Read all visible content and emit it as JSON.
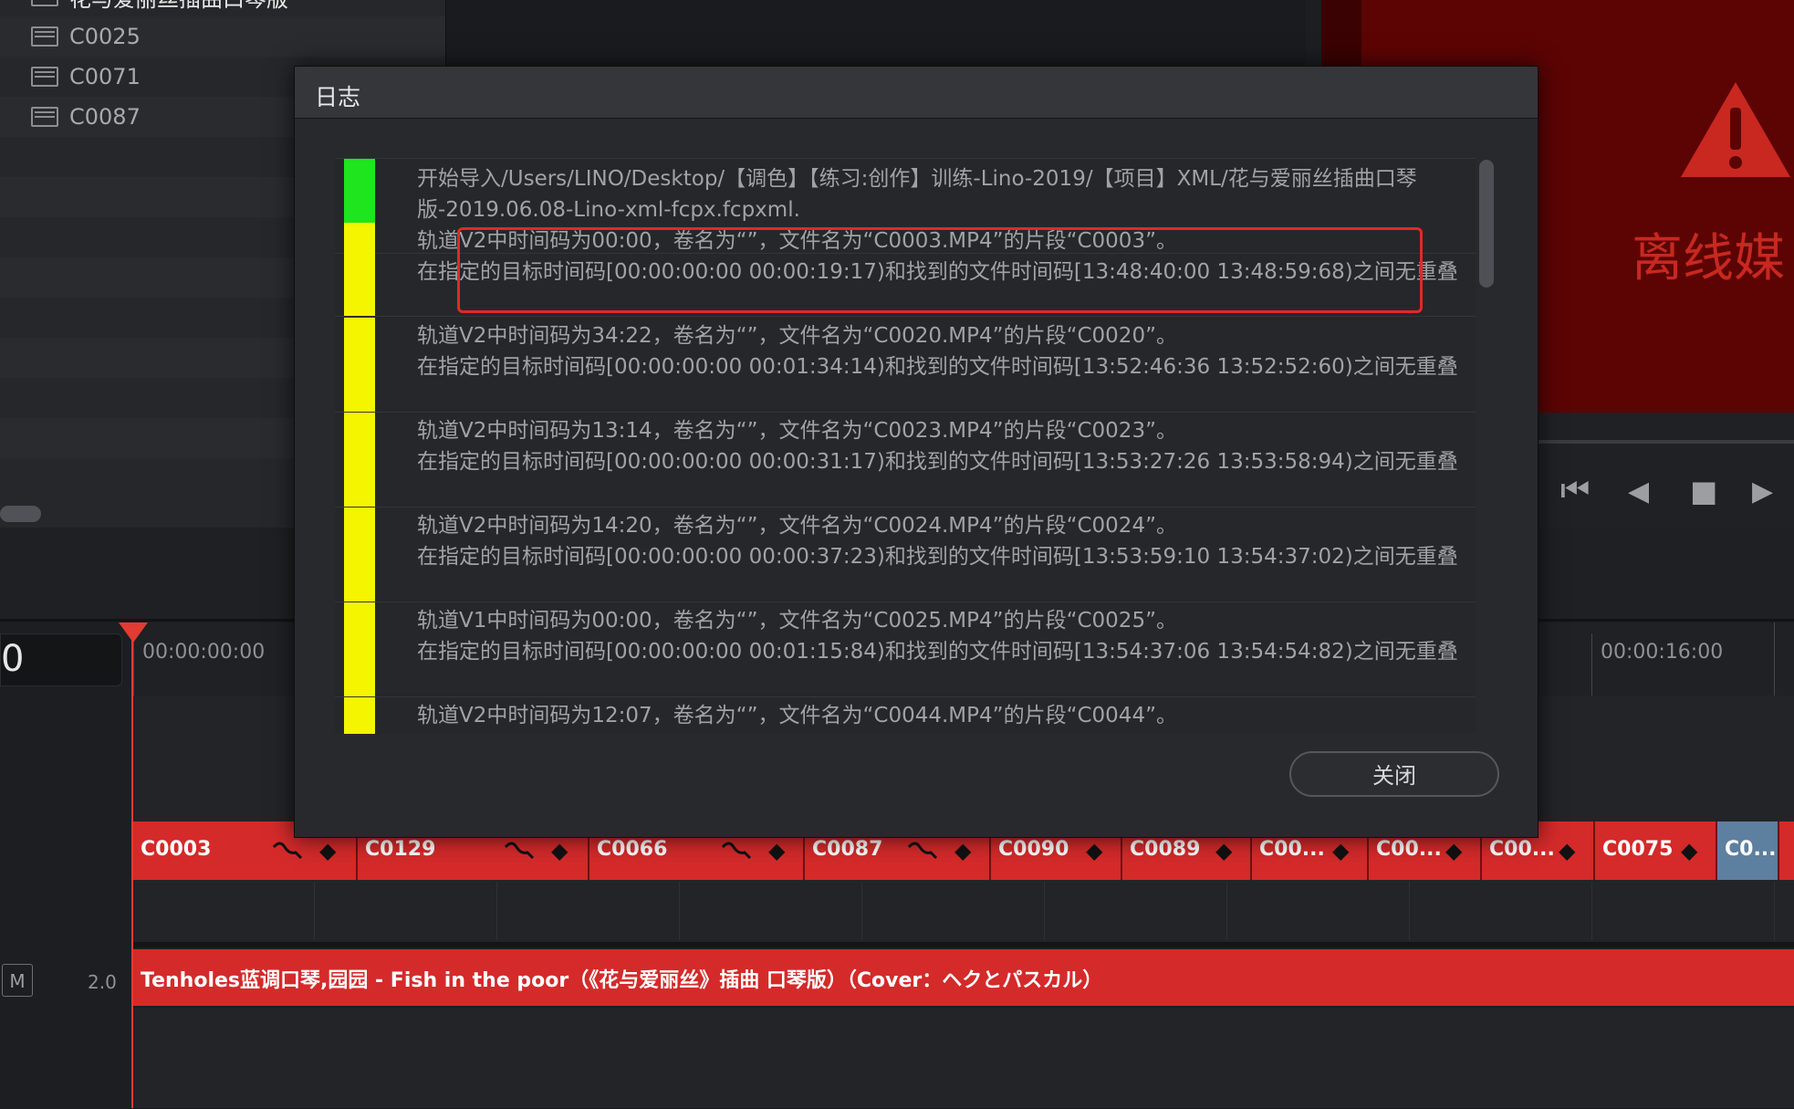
{
  "media_pool": {
    "items": [
      {
        "label": "花与爱丽丝插曲口琴版"
      },
      {
        "label": "C0025"
      },
      {
        "label": "C0071"
      },
      {
        "label": "C0087"
      }
    ]
  },
  "viewer": {
    "offline_text": "离线媒",
    "warning_icon": "warning-triangle-icon"
  },
  "timeline": {
    "current_timecode": "0",
    "ruler": {
      "start_label": "00:00:00:00",
      "mark_label": "00:00:16:00"
    },
    "video_clips": [
      {
        "label": "C0003",
        "has_wave": true
      },
      {
        "label": "C0129",
        "has_wave": true
      },
      {
        "label": "C0066",
        "has_wave": true
      },
      {
        "label": "C0087",
        "has_wave": true
      },
      {
        "label": "C0090",
        "has_wave": false
      },
      {
        "label": "C0089",
        "has_wave": false
      },
      {
        "label": "C00...",
        "has_wave": false
      },
      {
        "label": "C00...",
        "has_wave": false
      },
      {
        "label": "C00...",
        "has_wave": false
      },
      {
        "label": "C0075",
        "has_wave": false
      },
      {
        "label": "C0...",
        "has_wave": false
      }
    ],
    "audio_track": {
      "mute_label": "M",
      "level": "2.0",
      "clip_label": "Tenholes蓝调口琴,园园 - Fish in the poor（《花与爱丽丝》插曲 口琴版）（Cover：ヘクとパスカル）"
    }
  },
  "log_dialog": {
    "title": "日志",
    "entries": [
      {
        "color": "#1ee51e",
        "line1": "开始导入/Users/LINO/Desktop/【调色】【练习:创作】训练-Lino-2019/【项目】XML/花与爱丽丝插曲口琴",
        "line2": "版-2019.06.08-Lino-xml-fcpx.fcpxml."
      },
      {
        "color": "#f5f500",
        "line1": "轨道V2中时间码为00:00，卷名为“”，文件名为“C0003.MP4”的片段“C0003”。",
        "line2": "在指定的目标时间码[00:00:00:00 00:00:19:17)和找到的文件时间码[13:48:40:00 13:48:59:68)之间无重叠"
      },
      {
        "color": "#f5f500",
        "line1": "轨道V2中时间码为34:22，卷名为“”，文件名为“C0020.MP4”的片段“C0020”。",
        "line2": "在指定的目标时间码[00:00:00:00 00:01:34:14)和找到的文件时间码[13:52:46:36 13:52:52:60)之间无重叠"
      },
      {
        "color": "#f5f500",
        "line1": "轨道V2中时间码为13:14，卷名为“”，文件名为“C0023.MP4”的片段“C0023”。",
        "line2": "在指定的目标时间码[00:00:00:00 00:00:31:17)和找到的文件时间码[13:53:27:26 13:53:58:94)之间无重叠"
      },
      {
        "color": "#f5f500",
        "line1": "轨道V2中时间码为14:20，卷名为“”，文件名为“C0024.MP4”的片段“C0024”。",
        "line2": "在指定的目标时间码[00:00:00:00 00:00:37:23)和找到的文件时间码[13:53:59:10 13:54:37:02)之间无重叠"
      },
      {
        "color": "#f5f500",
        "line1": "轨道V1中时间码为00:00，卷名为“”，文件名为“C0025.MP4”的片段“C0025”。",
        "line2": "在指定的目标时间码[00:00:00:00 00:01:15:84)和找到的文件时间码[13:54:37:06 13:54:54:82)之间无重叠"
      },
      {
        "color": "#f5f500",
        "line1": "轨道V2中时间码为12:07，卷名为“”，文件名为“C0044.MP4”的片段“C0044”。",
        "line2": ""
      }
    ],
    "close_label": "关闭"
  }
}
